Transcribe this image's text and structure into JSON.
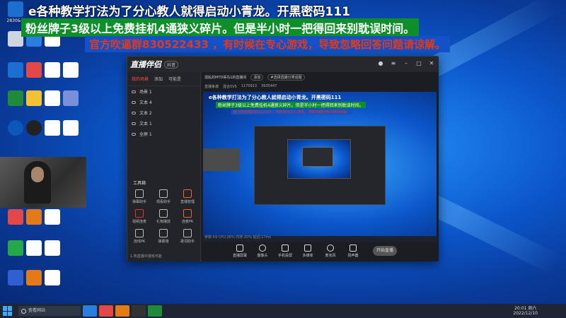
{
  "overlay": {
    "line1": "e各种教学打法为了分心教人就得启动小青龙。开黑密码111",
    "line2": "粉丝牌子3级以上免费挂机4通狭义碎片。但是半小时一把得回来别耽误时间。",
    "line3": "官方吹逼群830522433 ，有时候在专心游戏，导致忽略回答问题请谅解。"
  },
  "desktop": {
    "icons": [
      {
        "label": "2830&#",
        "color": "#1b6fd1"
      },
      {
        "label": "",
        "color": "#cfd6e0"
      },
      {
        "label": "",
        "color": "#2a7de1"
      },
      {
        "label": "",
        "color": "#e34848"
      },
      {
        "label": "",
        "color": "#1f8a3a"
      },
      {
        "label": "",
        "color": "#1a6fd8"
      },
      {
        "label": "",
        "color": "#0b58b8"
      },
      {
        "label": "",
        "color": "#222"
      },
      {
        "label": "",
        "color": "#e27a17"
      },
      {
        "label": "",
        "color": "#2b6dd8"
      },
      {
        "label": "",
        "color": "#25a84a"
      },
      {
        "label": "",
        "color": "#2f5fd0"
      }
    ]
  },
  "app": {
    "logo": "直播伴侣",
    "logo_tag": "抖音",
    "left_tabs": [
      "我的场景",
      "添加",
      "可能是"
    ],
    "scenes": [
      "场景 1",
      "文本 4",
      "文本 2",
      "文本 1",
      "全屏 1"
    ],
    "tools_title": "工具箱",
    "tools": [
      "弹幕助手",
      "观看助手",
      "直播管理",
      "视频连麦",
      "礼物播放",
      "连麦PK",
      "连线PK",
      "弹幕墙",
      "歌词助手"
    ],
    "footer": "1.热直播中游戏可能",
    "room_title": "混乱的MTD得鸟1的直播间",
    "room_chip1": "添加",
    "room_chip2": "#选择直播分类话题",
    "stat1": "直播争渡",
    "stat2": "混合5V5",
    "stat3": "1170913",
    "stat4": "3935447",
    "bottom": [
      "直播屏幕",
      "摄像头",
      "手机投屏",
      "多媒体",
      "麦克风",
      "扬声器"
    ],
    "start": "开始直播",
    "statusline": "参数:59  CPU:26%  内存:20%  延迟:17ms"
  },
  "taskbar": {
    "search": "查看网站",
    "clock_time": "20:01 周六",
    "clock_date": "2022/12/10"
  }
}
